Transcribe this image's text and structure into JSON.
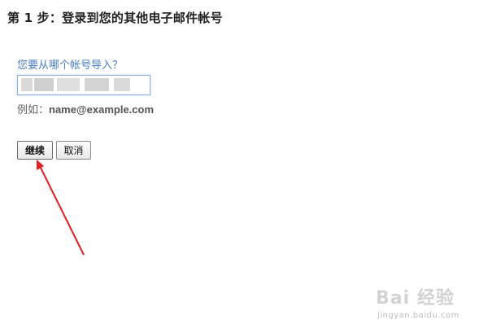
{
  "step": {
    "title": "第 1 步：登录到您的其他电子邮件帐号"
  },
  "form": {
    "question": "您要从哪个帐号导入？",
    "email_value": "",
    "example_prefix": "例如：",
    "example_address": "name@example.com"
  },
  "buttons": {
    "continue_label": "继续",
    "cancel_label": "取消"
  },
  "colors": {
    "link_blue": "#4a7dc7",
    "arrow_red": "#e02020",
    "input_focus": "#8fb1e8"
  },
  "watermark": {
    "logo_text": "Bai 经验",
    "sub_text": "jingyan.baidu.com"
  }
}
